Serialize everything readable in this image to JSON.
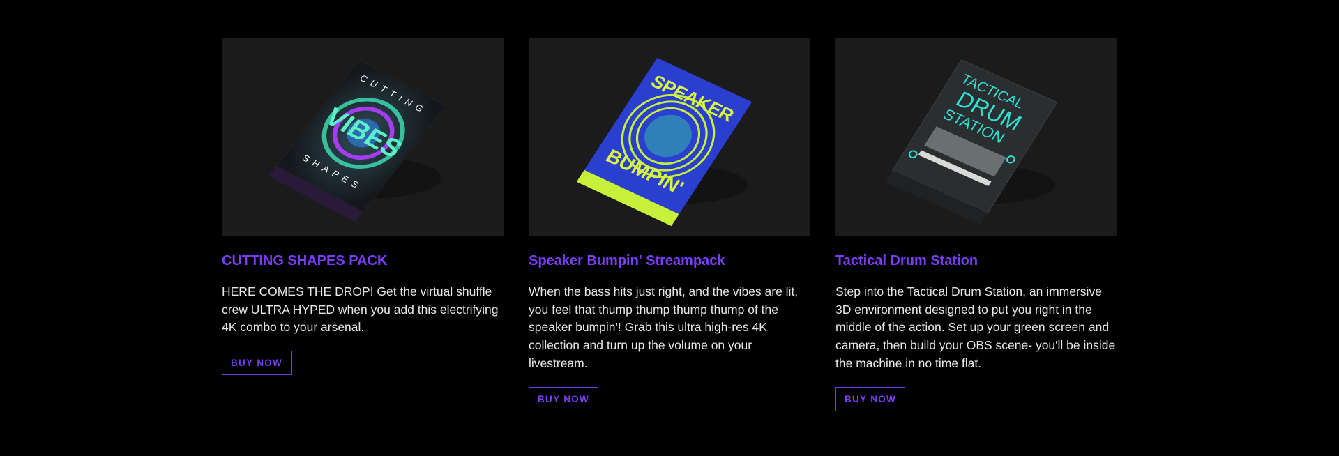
{
  "colors": {
    "accent": "#7b3df6",
    "background": "#000000",
    "media_bg": "#1b1b1b",
    "text": "#e6e6e6"
  },
  "products": [
    {
      "title": "CUTTING SHAPES PACK",
      "description": "HERE COMES THE DROP! Get the virtual shuffle crew ULTRA HYPED when you add this electrifying 4K combo to your arsenal.",
      "button": "BUY NOW",
      "box_top": "CUTTING",
      "box_bottom": "SHAPES",
      "box_main": "VIBES"
    },
    {
      "title": "Speaker Bumpin' Streampack",
      "description": "When the bass hits just right, and the vibes are lit, you feel that thump thump thump  thump of the speaker bumpin'! Grab this ultra high-res 4K collection and turn up the volume on your livestream.",
      "button": "BUY NOW",
      "box_top": "SPEAKER",
      "box_bottom": "BUMPIN'"
    },
    {
      "title": "Tactical Drum Station",
      "description": "Step into the Tactical Drum Station, an immersive 3D environment designed to put you right in the middle of the action. Set up your green screen and camera, then build your OBS scene- you'll be inside the machine in no time flat.",
      "button": "BUY NOW",
      "box_line1": "TACTICAL",
      "box_line2": "DRUM",
      "box_line3": "STATION"
    }
  ]
}
